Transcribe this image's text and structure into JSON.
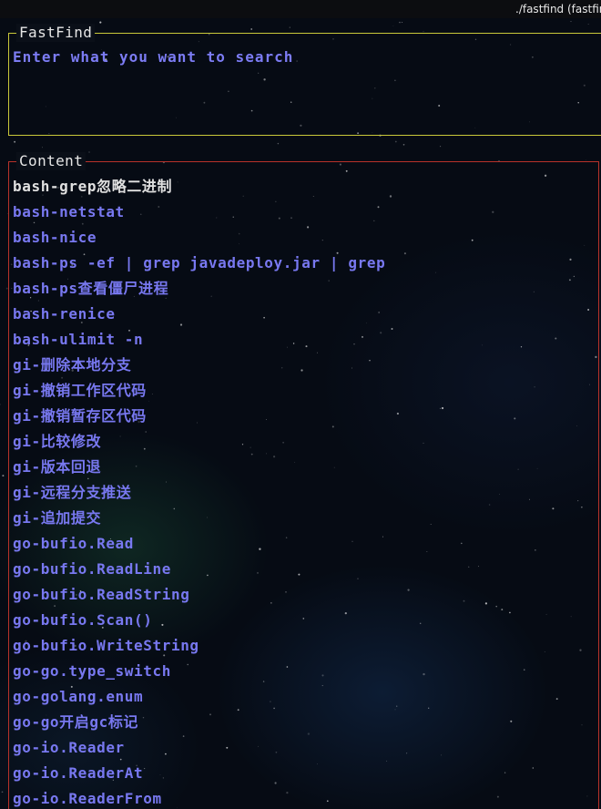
{
  "window": {
    "title": "./fastfind (fastfin"
  },
  "search": {
    "title": "FastFind",
    "placeholder": "Enter what you want to search"
  },
  "content": {
    "title": "Content",
    "selected_index": 0,
    "items": [
      "bash-grep忽略二进制",
      "bash-netstat",
      "bash-nice",
      "bash-ps -ef | grep javadeploy.jar | grep",
      "bash-ps查看僵尸进程",
      "bash-renice",
      "bash-ulimit -n",
      "gi-删除本地分支",
      "gi-撤销工作区代码",
      "gi-撤销暂存区代码",
      "gi-比较修改",
      "gi-版本回退",
      "gi-远程分支推送",
      "gi-追加提交",
      "go-bufio.Read",
      "go-bufio.ReadLine",
      "go-bufio.ReadString",
      "go-bufio.Scan()",
      "go-bufio.WriteString",
      "go-go.type_switch",
      "go-golang.enum",
      "go-go开启gc标记",
      "go-io.Reader",
      "go-io.ReaderAt",
      "go-io.ReaderFrom"
    ]
  },
  "colors": {
    "search_border": "#c9c93a",
    "content_border": "#b8322a",
    "item_text": "#7878f0",
    "selected_text": "#e0e0e0"
  }
}
